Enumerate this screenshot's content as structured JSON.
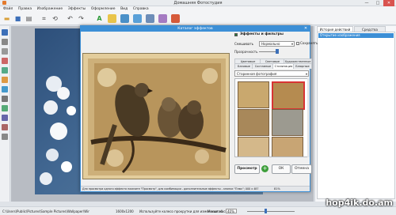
{
  "window": {
    "title": "Домашняя Фотостудия",
    "controls": [
      "—",
      "□",
      "✕"
    ]
  },
  "menu": [
    "Файл",
    "Правка",
    "Изображение",
    "Эффекты",
    "Оформление",
    "Вид",
    "Справка"
  ],
  "dialog": {
    "title": "Каталог эффектов",
    "effects_checkbox_label": "Эффекты и фильтры",
    "blend_label": "Смешивать",
    "blend_value": "Нормально",
    "save_checkbox_label": "Сохранять",
    "opacity_label": "Прозрачность",
    "tabs_row1": [
      "Цветовые",
      "Световые",
      "Художественные"
    ],
    "tabs_row2": [
      "Базовые",
      "Составные",
      "Стилизация",
      "Блюрные"
    ],
    "category_select": "Старинная фотография",
    "preview_button": "Просмотр",
    "ok_button": "ОК",
    "cancel_button": "Отмена",
    "status_hint": "Для просмотра одного эффекта нажмите \"Просмотр\", для комбинации - дополнительные эффекты - кнопки \"Плюс\"; 000 x 487",
    "status_zoom": "81%"
  },
  "right_panel": {
    "tabs": [
      "История действий",
      "Средства"
    ],
    "history_item": "Открытие изображения"
  },
  "status": {
    "path": "C:\\Users\\Public\\Pictures\\Sample Pictures\\Wallpaper\\Windows\\Blue.jpg",
    "size": "1600x1200",
    "hint": "Используйте колесо прокрутки для изменения масштаба",
    "zoom_label": "Масштаб",
    "zoom_value": "40%"
  },
  "watermark": "hop4ik.do.am",
  "colors": {
    "accent": "#3c8fd6",
    "selected_thumb": "#d83434",
    "sepia": "#b8935a"
  }
}
